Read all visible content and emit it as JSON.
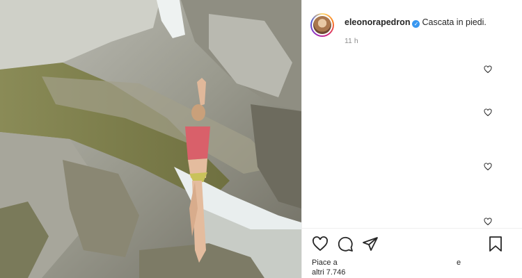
{
  "post": {
    "username": "eleonorapedron",
    "caption": "Cascata in piedi.",
    "time_ago": "11 h",
    "verified_mark": "✓"
  },
  "icons": {
    "comment_like": "heart-outline-icon",
    "like": "heart-outline-icon",
    "comment": "speech-bubble-icon",
    "share": "paper-plane-icon",
    "save": "bookmark-icon"
  },
  "likes": {
    "line1": "Piace a",
    "line2": "altri 7.746",
    "conjunction": "e"
  },
  "colors": {
    "verified_blue": "#3897f0",
    "text": "#262626",
    "muted": "#8e8e8e"
  }
}
